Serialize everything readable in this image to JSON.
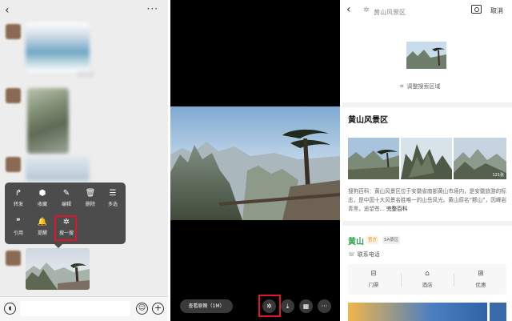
{
  "chat": {
    "back_icon": "chevron-left-icon",
    "more_icon": "more-dots-icon",
    "context_menu": {
      "items": [
        {
          "icon": "forward-icon",
          "glyph": "↱",
          "label": "转发"
        },
        {
          "icon": "cube-icon",
          "glyph": "⬢",
          "label": "收藏"
        },
        {
          "icon": "edit-icon",
          "glyph": "✎",
          "label": "编辑"
        },
        {
          "icon": "trash-icon",
          "glyph": "🗑",
          "label": "删除"
        },
        {
          "icon": "multiselect-icon",
          "glyph": "☰",
          "label": "多选"
        },
        {
          "icon": "quote-icon",
          "glyph": "❞",
          "label": "引用"
        },
        {
          "icon": "bell-icon",
          "glyph": "🔔",
          "label": "提醒"
        },
        {
          "icon": "sparkle-icon",
          "glyph": "✲",
          "label": "搜一搜"
        }
      ],
      "highlighted_label": "搜一搜",
      "highlight_color": "#e0142a"
    },
    "input_bar": {
      "voice_icon": "voice-icon",
      "emoji_icon": "emoji-icon",
      "plus_icon": "plus-icon"
    }
  },
  "viewer": {
    "view_original_label": "查看原图（1M）",
    "tools": [
      {
        "icon": "sparkle-icon",
        "glyph": "✲"
      },
      {
        "icon": "download-icon",
        "glyph": "⤓"
      },
      {
        "icon": "grid-icon",
        "glyph": "▦"
      },
      {
        "icon": "more-icon",
        "glyph": "···"
      }
    ],
    "highlight_color": "#e0142a"
  },
  "search": {
    "back_icon": "chevron-left-icon",
    "query": "黄山风景区",
    "search_icon": "sparkle-icon",
    "camera_icon": "camera-icon",
    "cancel_label": "取消",
    "adjust_label": "调整搜索区域",
    "adjust_icon": "crop-icon",
    "result_title": "黄山风景区",
    "photo_count": "121张",
    "description": "搜狗百科：黄山风景区位于安徽省南部黄山市境内，是安徽旅游的标志，是中国十大风景名胜唯一的山岳风光。黄山原名“黟山”，因峰岩青黑，遥望苍...",
    "more_label": "完整百科",
    "poi": {
      "title": "黄山",
      "tag_official": "官方",
      "tag_level": "5A景区",
      "contact_label": "联系电话",
      "contact_icon": "phone-icon",
      "services": [
        {
          "icon": "ticket-icon",
          "glyph": "⊟",
          "label": "门票"
        },
        {
          "icon": "hotel-icon",
          "glyph": "⌂",
          "label": "酒店"
        },
        {
          "icon": "coupon-icon",
          "glyph": "⊞",
          "label": "优惠"
        }
      ]
    },
    "accent_green": "#2aa34a"
  }
}
